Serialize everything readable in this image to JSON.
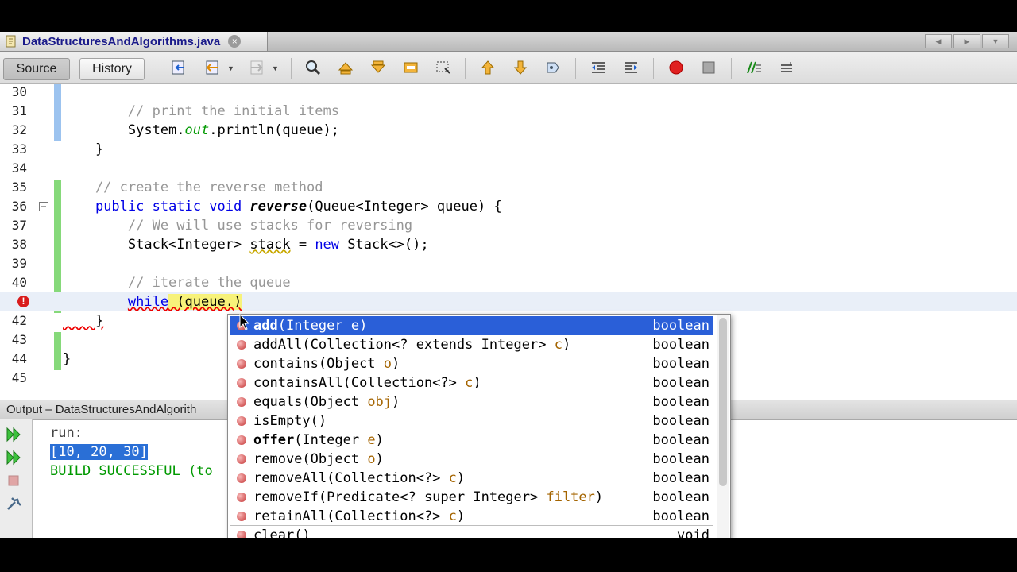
{
  "tab": {
    "filename": "DataStructuresAndAlgorithms.java",
    "close_glyph": "×"
  },
  "toolbar": {
    "source_label": "Source",
    "history_label": "History"
  },
  "editor": {
    "lines": [
      {
        "num": "30",
        "code": ""
      },
      {
        "num": "31",
        "code": "        // print the initial items"
      },
      {
        "num": "32",
        "code_a": "        System.",
        "code_b": "out",
        "code_c": ".println(queue);"
      },
      {
        "num": "33",
        "code": "    }"
      },
      {
        "num": "34",
        "code": ""
      },
      {
        "num": "35",
        "code": "    // create the reverse method"
      },
      {
        "num": "36",
        "kw1": "public static void ",
        "method": "reverse",
        "rest": "(Queue<Integer> queue) {"
      },
      {
        "num": "37",
        "code": "        // We will use stacks for reversing"
      },
      {
        "num": "38",
        "a": "        Stack<Integer> ",
        "b": "stack",
        "c": " = ",
        "kw": "new",
        "d": " Stack<>();"
      },
      {
        "num": "39",
        "code": ""
      },
      {
        "num": "40",
        "code": "        // iterate the queue"
      },
      {
        "num": "41",
        "kw": "while",
        "rest": " (queue.)"
      },
      {
        "num": "42",
        "code": "    }"
      },
      {
        "num": "43",
        "code": ""
      },
      {
        "num": "44",
        "code": "}"
      },
      {
        "num": "45",
        "code": ""
      }
    ]
  },
  "output": {
    "title": "Output – DataStructuresAndAlgorith",
    "lines": [
      "run:",
      "[10, 20, 30]",
      "BUILD SUCCESSFUL (to"
    ]
  },
  "completion": {
    "items": [
      {
        "name": "add",
        "pre": "(Integer ",
        "param": "e",
        "post": ")",
        "ret": "boolean",
        "bold": true
      },
      {
        "name": "addAll",
        "pre": "(Collection<? extends Integer> ",
        "param": "c",
        "post": ")",
        "ret": "boolean"
      },
      {
        "name": "contains",
        "pre": "(Object ",
        "param": "o",
        "post": ")",
        "ret": "boolean"
      },
      {
        "name": "containsAll",
        "pre": "(Collection<?> ",
        "param": "c",
        "post": ")",
        "ret": "boolean"
      },
      {
        "name": "equals",
        "pre": "(Object ",
        "param": "obj",
        "post": ")",
        "ret": "boolean"
      },
      {
        "name": "isEmpty",
        "pre": "()",
        "param": "",
        "post": "",
        "ret": "boolean"
      },
      {
        "name": "offer",
        "pre": "(Integer ",
        "param": "e",
        "post": ")",
        "ret": "boolean",
        "bold": true
      },
      {
        "name": "remove",
        "pre": "(Object ",
        "param": "o",
        "post": ")",
        "ret": "boolean"
      },
      {
        "name": "removeAll",
        "pre": "(Collection<?> ",
        "param": "c",
        "post": ")",
        "ret": "boolean"
      },
      {
        "name": "removeIf",
        "pre": "(Predicate<? super Integer> ",
        "param": "filter",
        "post": ")",
        "ret": "boolean"
      },
      {
        "name": "retainAll",
        "pre": "(Collection<?> ",
        "param": "c",
        "post": ")",
        "ret": "boolean"
      },
      {
        "name": "clear",
        "pre": "()",
        "param": "",
        "post": "",
        "ret": "void"
      }
    ]
  }
}
